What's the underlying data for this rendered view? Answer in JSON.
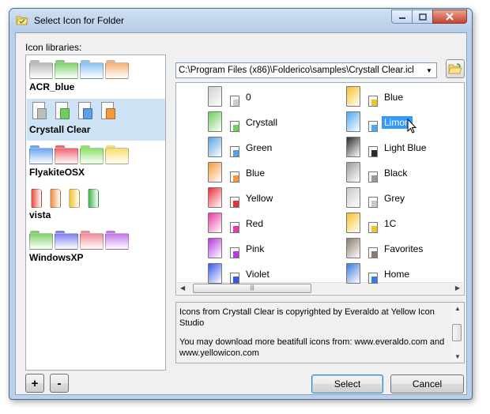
{
  "window": {
    "title": "Select Icon for Folder"
  },
  "libraries_label": "Icon libraries:",
  "libraries": [
    {
      "name": "ACR_blue",
      "style": "folders",
      "colors": [
        "#b9b9b9",
        "#7ed36a",
        "#8cc3ef",
        "#f4b07a"
      ]
    },
    {
      "name": "Crystall Clear",
      "style": "docs",
      "selected": true,
      "colors": [
        "#bdbdbd",
        "#6fce5d",
        "#5aa0e6",
        "#f59a3a"
      ]
    },
    {
      "name": "FlyakiteOSX",
      "style": "folders",
      "colors": [
        "#6aa6f0",
        "#f0646e",
        "#8ee06a",
        "#f7df6a"
      ]
    },
    {
      "name": "vista",
      "style": "thin",
      "colors": [
        "#e84b3a",
        "#f08a3c",
        "#f2c22a",
        "#3fb24a"
      ]
    },
    {
      "name": "WindowsXP",
      "style": "folders",
      "colors": [
        "#7fd36a",
        "#7f7ff0",
        "#f08a9a",
        "#c07ae8"
      ]
    }
  ],
  "path": "C:\\Program Files (x86)\\Folderico\\samples\\Crystall Clear.icl",
  "icons_left": [
    {
      "name": "0",
      "color": "#cfcfcf"
    },
    {
      "name": "Crystall",
      "color": "#6fce5d"
    },
    {
      "name": "Green",
      "color": "#5aa0e6"
    },
    {
      "name": "Blue",
      "color": "#f59a3a"
    },
    {
      "name": "Yellow",
      "color": "#e8303a"
    },
    {
      "name": "Red",
      "color": "#e83aa6"
    },
    {
      "name": "Pink",
      "color": "#b53ae0"
    },
    {
      "name": "Violet",
      "color": "#3a58e8"
    }
  ],
  "icons_right": [
    {
      "name": "Blue",
      "color": "#f2c22a"
    },
    {
      "name": "Limon",
      "color": "#4aa8f0",
      "selected": true
    },
    {
      "name": "Light Blue",
      "color": "#2a2a2a"
    },
    {
      "name": "Black",
      "color": "#9a9a9a"
    },
    {
      "name": "Grey",
      "color": "#c8c8c8"
    },
    {
      "name": "1C",
      "color": "#f2c22a"
    },
    {
      "name": "Favorites",
      "color": "#8a7a6a"
    },
    {
      "name": "Home",
      "color": "#3a7ae0"
    }
  ],
  "description": {
    "line1": "Icons from Crystall Clear is copyrighted by Everaldo at Yellow Icon Studio",
    "line2": "You may download more beatifull icons from: www.everaldo.com and www.yellowicon.com"
  },
  "buttons": {
    "add": "+",
    "remove": "-",
    "select": "Select",
    "cancel": "Cancel"
  }
}
